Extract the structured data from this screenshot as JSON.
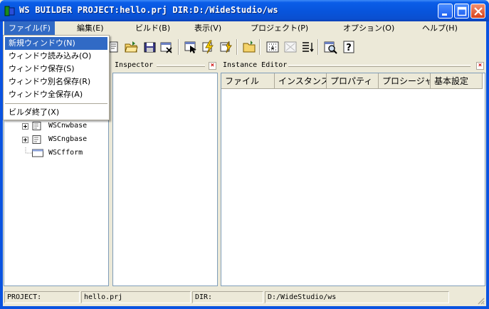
{
  "window": {
    "title": "WS BUILDER PROJECT:hello.prj DIR:D:/WideStudio/ws",
    "accent": "#0a53e0",
    "menu_highlight": "#316ac5"
  },
  "menubar": {
    "items": [
      {
        "label": "ファイル(F)"
      },
      {
        "label": "編集(E)"
      },
      {
        "label": "ビルド(B)"
      },
      {
        "label": "表示(V)"
      },
      {
        "label": "プロジェクト(P)"
      },
      {
        "label": "オプション(O)"
      },
      {
        "label": "ヘルプ(H)"
      }
    ]
  },
  "file_menu": {
    "items": [
      {
        "label": "新規ウィンドウ(N)"
      },
      {
        "label": "ウィンドウ読み込み(O)"
      },
      {
        "label": "ウィンドウ保存(S)"
      },
      {
        "label": "ウィンドウ別名保存(R)"
      },
      {
        "label": "ウィンドウ全保存(A)"
      },
      {
        "label": "ビルダ終了(X)"
      }
    ]
  },
  "toolbar": {
    "icons": [
      "open-folder-icon",
      "save-icon",
      "close-window-icon",
      "select-icon",
      "build-icon",
      "run-icon",
      "folder-icon",
      "grid-icon",
      "align-icon",
      "list-icon",
      "preview-icon",
      "help-icon"
    ]
  },
  "tree": {
    "nodes": [
      {
        "label": "WSCnwbase",
        "icon": "class-icon"
      },
      {
        "label": "WSCngbase",
        "icon": "class-icon"
      },
      {
        "label": "WSCfform",
        "icon": "form-icon"
      }
    ]
  },
  "inspector": {
    "title": "Inspector"
  },
  "instance_editor": {
    "title": "Instance Editor",
    "tabs": [
      {
        "label": "ファイル"
      },
      {
        "label": "インスタンス"
      },
      {
        "label": "プロパティ"
      },
      {
        "label": "プロシージャ"
      },
      {
        "label": "基本設定"
      }
    ]
  },
  "statusbar": {
    "project_label": "PROJECT:",
    "project_value": "hello.prj",
    "dir_label": "DIR:",
    "dir_value": "D:/WideStudio/ws"
  }
}
